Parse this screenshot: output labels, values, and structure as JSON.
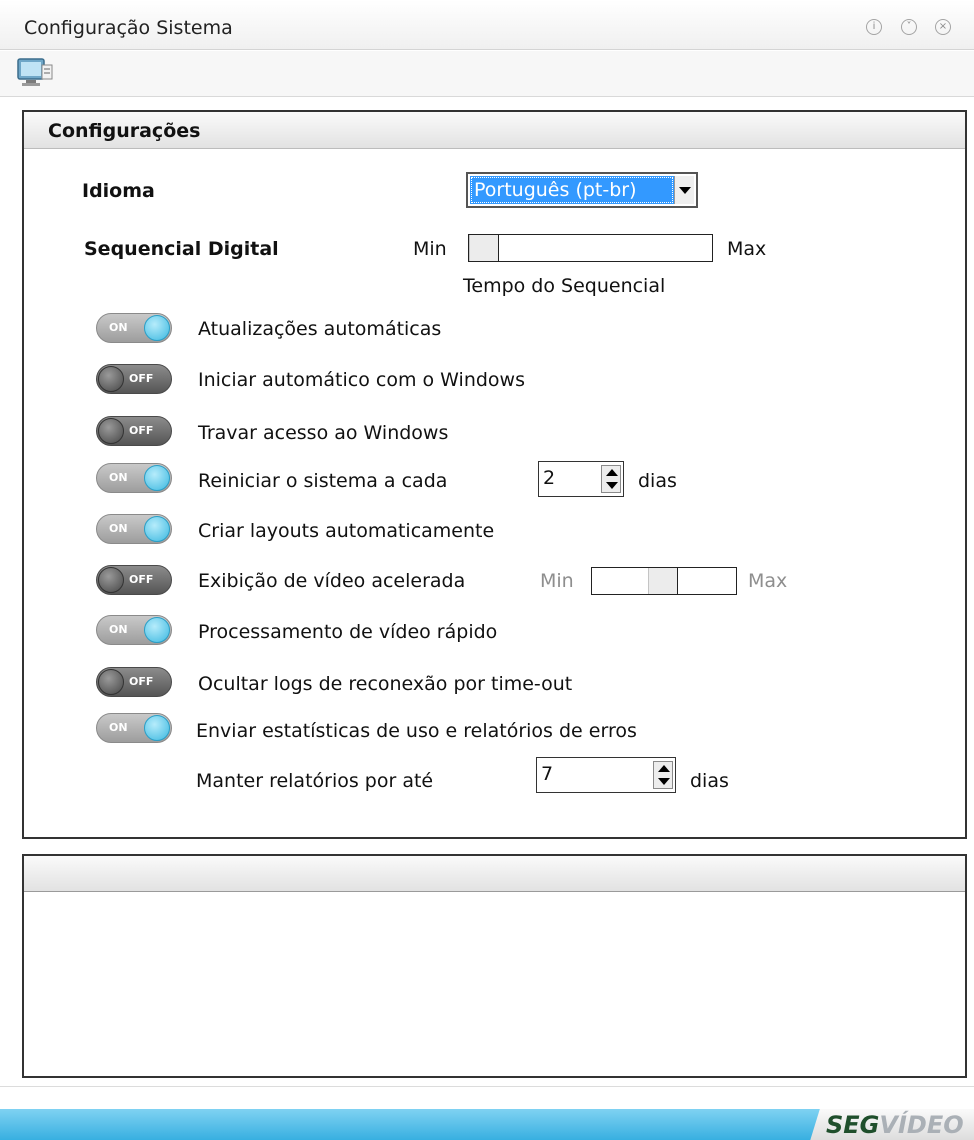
{
  "window": {
    "title": "Configuração Sistema",
    "buttons": [
      "info-icon",
      "minimize-icon",
      "close-icon"
    ]
  },
  "toolbar": {
    "icon": "computer-settings-icon"
  },
  "config": {
    "header": "Configurações",
    "idioma": {
      "label": "Idioma",
      "selected": "Português (pt-br)"
    },
    "sequencial": {
      "label": "Sequencial Digital",
      "min_label": "Min",
      "max_label": "Max",
      "caption": "Tempo do Sequencial"
    },
    "toggle_on_text": "ON",
    "toggle_off_text": "OFF",
    "options": [
      {
        "label": "Atualizações automáticas",
        "state": "on"
      },
      {
        "label": "Iniciar automático com o Windows",
        "state": "off"
      },
      {
        "label": "Travar acesso ao Windows",
        "state": "off"
      },
      {
        "label": "Reiniciar o sistema a cada",
        "state": "on",
        "value": "2",
        "unit": "dias"
      },
      {
        "label": "Criar layouts automaticamente",
        "state": "on"
      },
      {
        "label": "Exibição de vídeo acelerada",
        "state": "off",
        "min_label": "Min",
        "max_label": "Max"
      },
      {
        "label": "Processamento de vídeo rápido",
        "state": "on"
      },
      {
        "label": "Ocultar logs de reconexão por time-out",
        "state": "off"
      },
      {
        "label": "Enviar estatísticas de uso e relatórios de erros",
        "state": "on"
      }
    ],
    "manter": {
      "label": "Manter relatórios por até",
      "value": "7",
      "unit": "dias"
    }
  },
  "footer": {
    "logo_part1": "SEG",
    "logo_part2": "VÍDEO"
  },
  "colors": {
    "accent_blue": "#3399ff",
    "toggle_knob_on": "#3cb8e0",
    "footer_bar": "#35aee0",
    "logo_green": "#1f4f2c"
  }
}
